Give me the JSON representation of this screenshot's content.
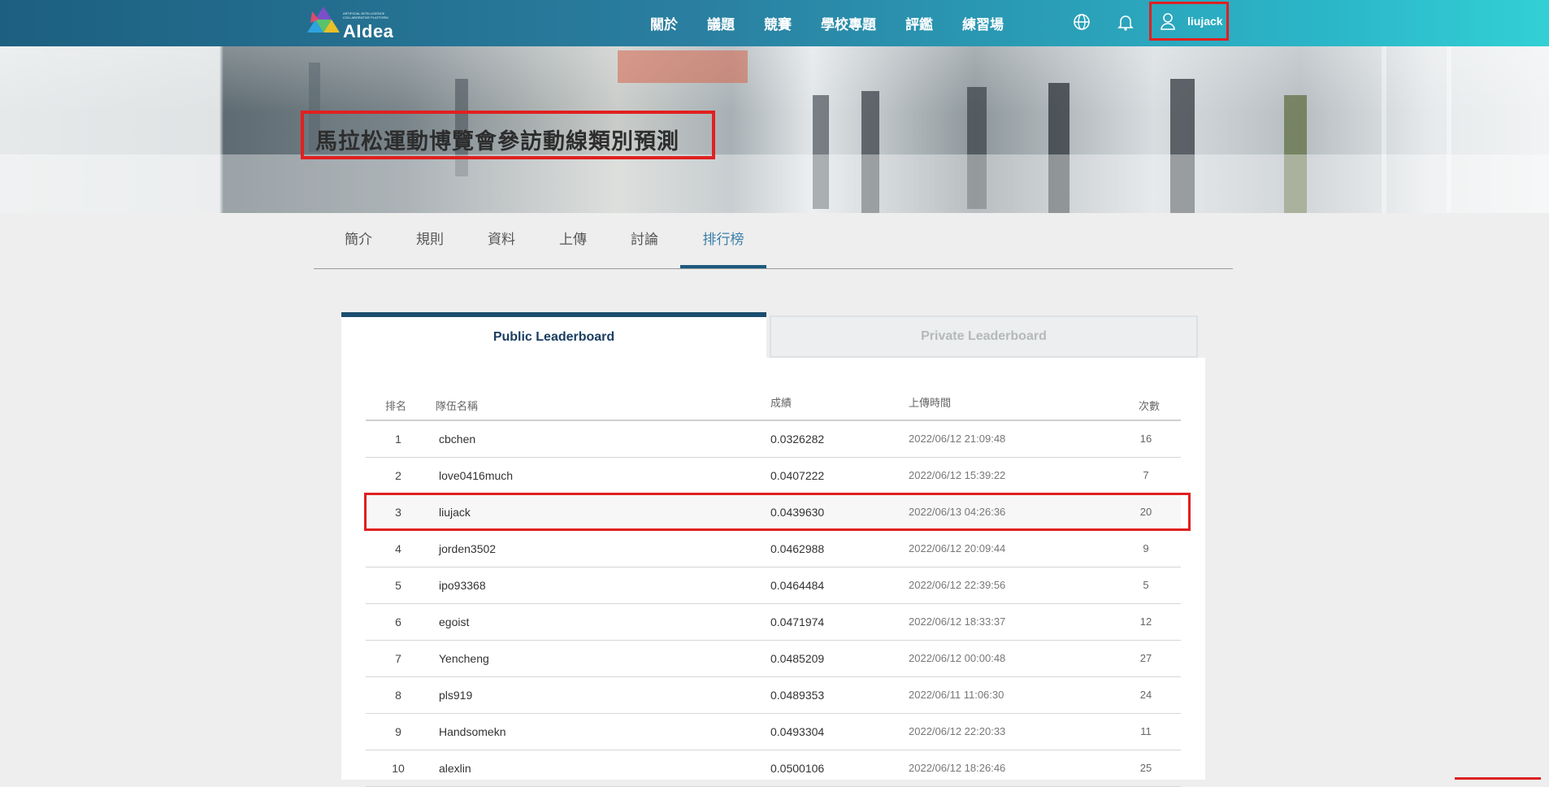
{
  "brand": {
    "logo_text": "AIdea",
    "logo_tagline_1": "ARTIFICIAL INTELLIGENCE",
    "logo_tagline_2": "COLLABORATIVE PLATFORM"
  },
  "nav": {
    "items": [
      "關於",
      "議題",
      "競賽",
      "學校專題",
      "評鑑",
      "練習場"
    ],
    "username": "liujack"
  },
  "hero": {
    "title": "馬拉松運動博覽會參訪動線類別預測"
  },
  "subtabs": [
    "簡介",
    "規則",
    "資料",
    "上傳",
    "討論",
    "排行榜"
  ],
  "leaderboard": {
    "tabs": {
      "public": "Public Leaderboard",
      "private": "Private Leaderboard"
    },
    "columns": {
      "rank": "排名",
      "team": "隊伍名稱",
      "score": "成績",
      "time": "上傳時間",
      "count": "次數"
    },
    "rows": [
      {
        "rank": "1",
        "team": "cbchen",
        "score": "0.0326282",
        "time": "2022/06/12 21:09:48",
        "count": "16"
      },
      {
        "rank": "2",
        "team": "love0416much",
        "score": "0.0407222",
        "time": "2022/06/12 15:39:22",
        "count": "7"
      },
      {
        "rank": "3",
        "team": "liujack",
        "score": "0.0439630",
        "time": "2022/06/13 04:26:36",
        "count": "20"
      },
      {
        "rank": "4",
        "team": "jorden3502",
        "score": "0.0462988",
        "time": "2022/06/12 20:09:44",
        "count": "9"
      },
      {
        "rank": "5",
        "team": "ipo93368",
        "score": "0.0464484",
        "time": "2022/06/12 22:39:56",
        "count": "5"
      },
      {
        "rank": "6",
        "team": "egoist",
        "score": "0.0471974",
        "time": "2022/06/12 18:33:37",
        "count": "12"
      },
      {
        "rank": "7",
        "team": "Yencheng",
        "score": "0.0485209",
        "time": "2022/06/12 00:00:48",
        "count": "27"
      },
      {
        "rank": "8",
        "team": "pls919",
        "score": "0.0489353",
        "time": "2022/06/11 11:06:30",
        "count": "24"
      },
      {
        "rank": "9",
        "team": "Handsomekn",
        "score": "0.0493304",
        "time": "2022/06/12 22:20:33",
        "count": "11"
      },
      {
        "rank": "10",
        "team": "alexlin",
        "score": "0.0500106",
        "time": "2022/06/12 18:26:46",
        "count": "25"
      }
    ]
  },
  "colors": {
    "highlight": "#e02020",
    "accent": "#1b4e6e"
  }
}
